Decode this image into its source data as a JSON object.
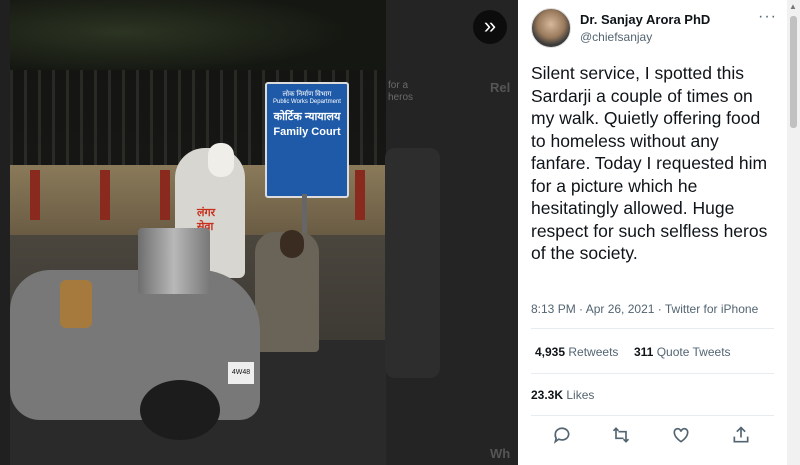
{
  "media": {
    "next_label": "»",
    "sign": {
      "line1": "लोक निर्माण विभाग",
      "line2": "Public Works Department",
      "line3": "कोर्टिक न्यायालय",
      "line4": "Family Court"
    },
    "shirt_text": [
      "लंगर",
      "सेवा"
    ],
    "plate_text": "4W48",
    "ghost": {
      "rel": "Rel",
      "caption": "for a heros",
      "bottom": "Wh"
    }
  },
  "tweet": {
    "author_name": "Dr. Sanjay Arora PhD",
    "author_handle": "@chiefsanjay",
    "more_label": "···",
    "text": "Silent service, I spotted this Sardarji a couple of times on my walk. Quietly offering food to homeless without any fanfare. Today I requested him for a picture which he hesitatingly allowed. Huge respect for such selfless heros of the society.",
    "time": "8:13 PM · Apr 26, 2021",
    "separator": " · ",
    "source": "Twitter for iPhone",
    "retweets_count": "4,935",
    "retweets_label": "Retweets",
    "quotes_count": "311",
    "quotes_label": "Quote Tweets",
    "likes_count": "23.3K",
    "likes_label": "Likes",
    "actions": [
      "reply-icon",
      "retweet-icon",
      "like-icon",
      "share-icon"
    ]
  },
  "colors": {
    "text": "#0f1419",
    "muted": "#536471",
    "divider": "#e6ecf0",
    "sign_blue": "#1e5aa8"
  }
}
